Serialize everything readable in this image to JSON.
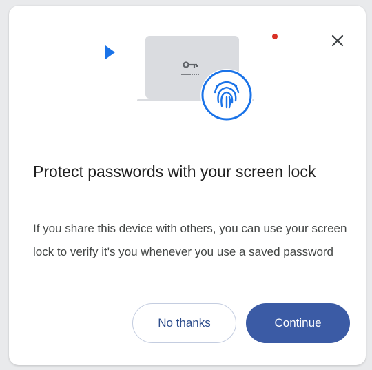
{
  "dialog": {
    "title": "Protect passwords with your screen lock",
    "description": "If you share this device with others, you can use your screen lock to verify it's you whenever you use a saved password",
    "secondary_button_label": "No thanks",
    "primary_button_label": "Continue"
  },
  "icons": {
    "close": "close-icon",
    "illustration": "laptop-fingerprint-illustration",
    "fingerprint": "fingerprint-icon",
    "key": "key-icon",
    "play": "play-triangle-icon"
  },
  "colors": {
    "accent_blue": "#1a73e8",
    "primary_button": "#3b5ba5",
    "red_dot": "#d93025",
    "laptop_gray": "#dadce0"
  }
}
